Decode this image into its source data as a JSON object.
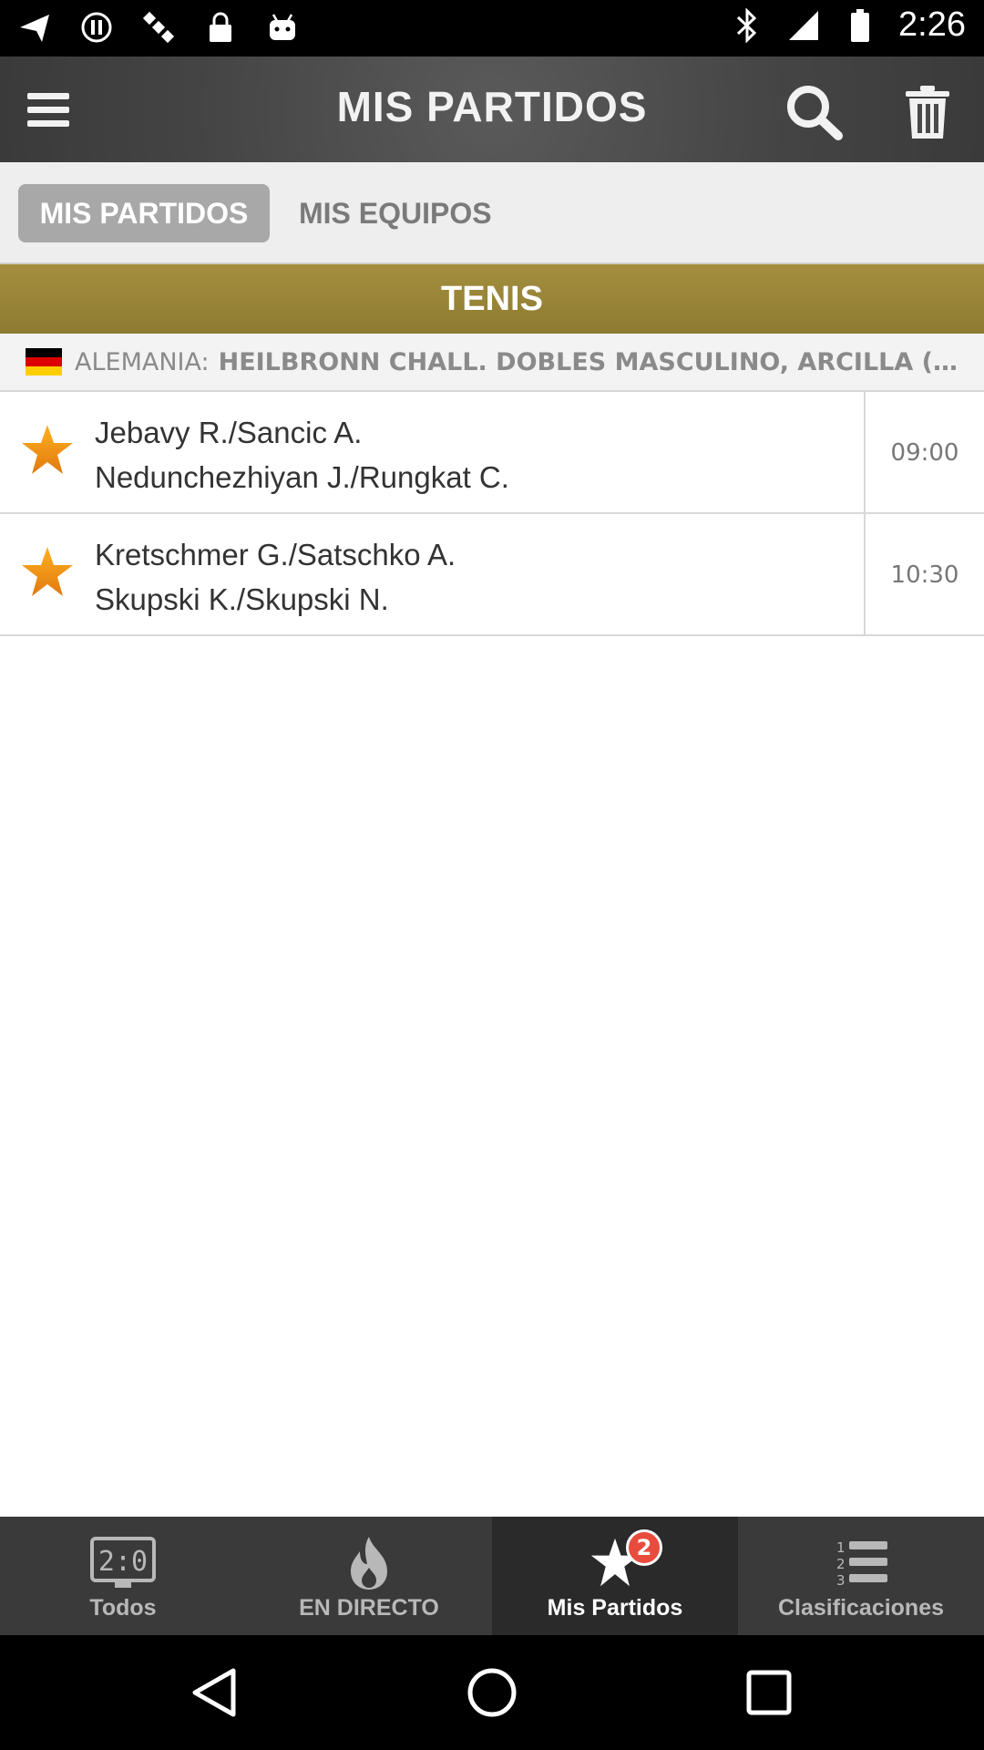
{
  "status_bar": {
    "time": "2:26",
    "left_icons": [
      "navigation-icon",
      "alert-icon",
      "satellite-icon",
      "lock-icon",
      "android-icon"
    ],
    "right_icons": [
      "bluetooth-icon",
      "signal-icon",
      "battery-icon"
    ]
  },
  "header": {
    "title": "MIS PARTIDOS"
  },
  "subtabs": [
    {
      "label": "MIS PARTIDOS",
      "active": true
    },
    {
      "label": "MIS EQUIPOS",
      "active": false
    }
  ],
  "section": {
    "title": "TENIS"
  },
  "league": {
    "country": "ALEMANIA:",
    "name": "HEILBRONN CHALL. DOBLES MASCULINO, ARCILLA (IND...",
    "flag_colors": [
      "#000000",
      "#dd0000",
      "#ffce00"
    ]
  },
  "matches": [
    {
      "team1": "Jebavy R./Sancic A.",
      "team2": "Nedunchezhiyan J./Rungkat C.",
      "time": "09:00"
    },
    {
      "team1": "Kretschmer G./Satschko A.",
      "team2": "Skupski K./Skupski N.",
      "time": "10:30"
    }
  ],
  "bottom_nav": [
    {
      "label": "Todos",
      "icon": "scoreboard-icon"
    },
    {
      "label": "EN DIRECTO",
      "icon": "flame-icon"
    },
    {
      "label": "Mis Partidos",
      "icon": "star-icon",
      "badge": "2",
      "active": true
    },
    {
      "label": "Clasificaciones",
      "icon": "ranking-list-icon"
    }
  ],
  "colors": {
    "header_bg": "#444444",
    "section_bg": "#9a853a",
    "star": "#f0a020",
    "badge": "#e84c3d"
  }
}
